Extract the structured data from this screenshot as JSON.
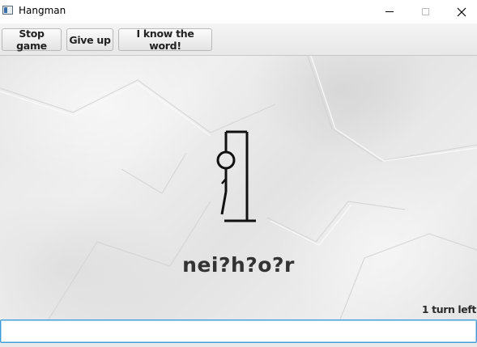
{
  "window": {
    "title": "Hangman",
    "icons": [
      "app-icon",
      "minimize-icon",
      "maximize-icon",
      "close-icon"
    ]
  },
  "toolbar": {
    "stop_game_label": "Stop game",
    "give_up_label": "Give up",
    "know_word_label": "I know the word!"
  },
  "game": {
    "masked_word": "nei?h?o?r",
    "turns_left": "1 turn left",
    "hangman_parts_drawn": [
      "base",
      "post",
      "head",
      "body",
      "left-leg"
    ]
  },
  "guess": {
    "value": ""
  },
  "colors": {
    "input_focus_border": "#3c9bd8",
    "figure_stroke": "#111111",
    "word_text": "#333333"
  }
}
